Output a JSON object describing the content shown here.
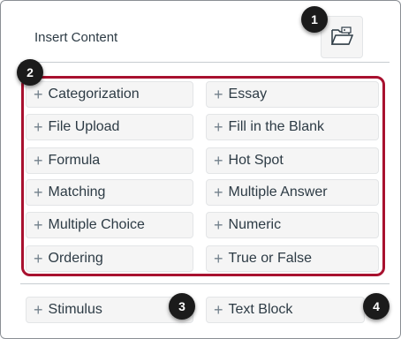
{
  "panel": {
    "title": "Insert Content",
    "folder_icon": "folder-icon"
  },
  "items": [
    {
      "label": "Categorization",
      "icon": "plus-icon"
    },
    {
      "label": "Essay",
      "icon": "plus-icon"
    },
    {
      "label": "File Upload",
      "icon": "plus-icon"
    },
    {
      "label": "Fill in the Blank",
      "icon": "plus-icon"
    },
    {
      "label": "Formula",
      "icon": "plus-icon"
    },
    {
      "label": "Hot Spot",
      "icon": "plus-icon"
    },
    {
      "label": "Matching",
      "icon": "plus-icon"
    },
    {
      "label": "Multiple Answer",
      "icon": "plus-icon"
    },
    {
      "label": "Multiple Choice",
      "icon": "plus-icon"
    },
    {
      "label": "Numeric",
      "icon": "plus-icon"
    },
    {
      "label": "Ordering",
      "icon": "plus-icon"
    },
    {
      "label": "True or False",
      "icon": "plus-icon"
    }
  ],
  "extras": [
    {
      "label": "Stimulus",
      "icon": "plus-icon"
    },
    {
      "label": "Text Block",
      "icon": "plus-icon"
    }
  ],
  "plus_symbol": "+",
  "callouts": [
    "1",
    "2",
    "3",
    "4"
  ],
  "colors": {
    "highlight_border": "#a8112f",
    "callout_bg": "#1b1b1b",
    "item_bg": "#f5f5f5"
  }
}
